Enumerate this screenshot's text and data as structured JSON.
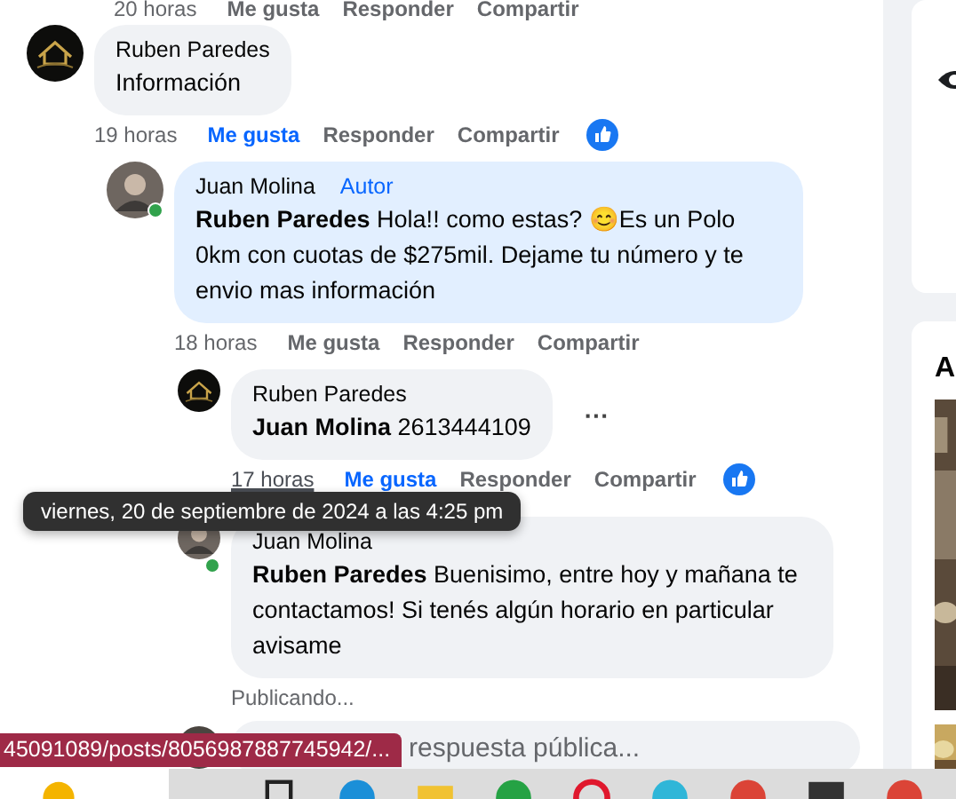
{
  "top_actions": {
    "time": "20 horas",
    "like": "Me gusta",
    "reply": "Responder",
    "share": "Compartir"
  },
  "comments": [
    {
      "kind": "page",
      "author": "Ruben Paredes",
      "text": "Información",
      "time": "19 horas",
      "like": "Me gusta",
      "liked": true,
      "reply": "Responder",
      "share": "Compartir",
      "reaction": true,
      "children": [
        {
          "kind": "user",
          "online": true,
          "author": "Juan Molina",
          "badge": "Autor",
          "highlighted": true,
          "mention": "Ruben Paredes",
          "text": "Hola!! como estas? 😊Es un Polo 0km con cuotas de $275mil. Dejame tu número y te envio mas información",
          "time": "18 horas",
          "like": "Me gusta",
          "liked": false,
          "reply": "Responder",
          "share": "Compartir",
          "reaction": false,
          "children": [
            {
              "kind": "page",
              "author": "Ruben Paredes",
              "mention": "Juan Molina",
              "text": "2613444109",
              "more": "···",
              "time": "17 horas",
              "time_hovered": true,
              "like": "Me gusta",
              "liked": true,
              "reply": "Responder",
              "share": "Compartir",
              "reaction": true
            },
            {
              "kind": "user",
              "online": true,
              "author": "Juan Molina",
              "mention": "Ruben Paredes",
              "text": "Buenisimo, entre hoy y mañana te contactamos! Si tenés algún horario en particular avisame",
              "status": "Publicando..."
            }
          ]
        }
      ]
    }
  ],
  "reply_field": {
    "placeholder": "respuesta pública..."
  },
  "tooltip": "viernes, 20 de septiembre de 2024 a las 4:25 pm",
  "status_url": "45091089/posts/8056987887745942/...",
  "sidebar": {
    "heading": "A"
  }
}
